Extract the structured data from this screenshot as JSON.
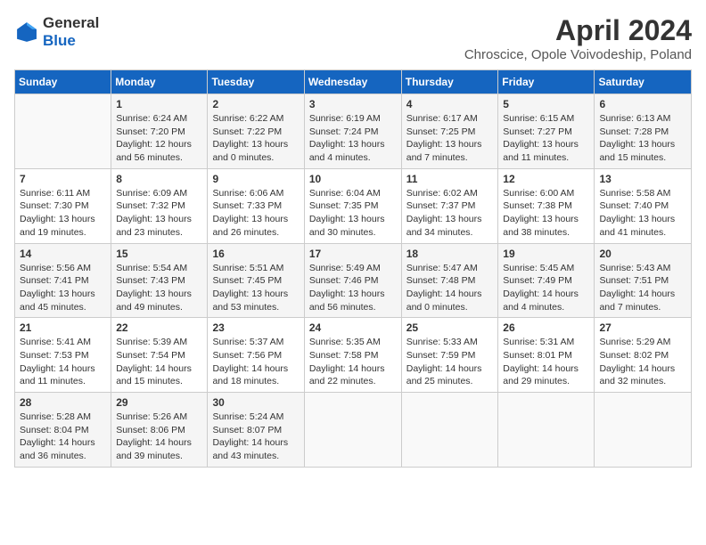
{
  "header": {
    "logo_line1": "General",
    "logo_line2": "Blue",
    "month_year": "April 2024",
    "location": "Chroscice, Opole Voivodeship, Poland"
  },
  "weekdays": [
    "Sunday",
    "Monday",
    "Tuesday",
    "Wednesday",
    "Thursday",
    "Friday",
    "Saturday"
  ],
  "weeks": [
    [
      {
        "day": "",
        "sunrise": "",
        "sunset": "",
        "daylight": ""
      },
      {
        "day": "1",
        "sunrise": "Sunrise: 6:24 AM",
        "sunset": "Sunset: 7:20 PM",
        "daylight": "Daylight: 12 hours and 56 minutes."
      },
      {
        "day": "2",
        "sunrise": "Sunrise: 6:22 AM",
        "sunset": "Sunset: 7:22 PM",
        "daylight": "Daylight: 13 hours and 0 minutes."
      },
      {
        "day": "3",
        "sunrise": "Sunrise: 6:19 AM",
        "sunset": "Sunset: 7:24 PM",
        "daylight": "Daylight: 13 hours and 4 minutes."
      },
      {
        "day": "4",
        "sunrise": "Sunrise: 6:17 AM",
        "sunset": "Sunset: 7:25 PM",
        "daylight": "Daylight: 13 hours and 7 minutes."
      },
      {
        "day": "5",
        "sunrise": "Sunrise: 6:15 AM",
        "sunset": "Sunset: 7:27 PM",
        "daylight": "Daylight: 13 hours and 11 minutes."
      },
      {
        "day": "6",
        "sunrise": "Sunrise: 6:13 AM",
        "sunset": "Sunset: 7:28 PM",
        "daylight": "Daylight: 13 hours and 15 minutes."
      }
    ],
    [
      {
        "day": "7",
        "sunrise": "Sunrise: 6:11 AM",
        "sunset": "Sunset: 7:30 PM",
        "daylight": "Daylight: 13 hours and 19 minutes."
      },
      {
        "day": "8",
        "sunrise": "Sunrise: 6:09 AM",
        "sunset": "Sunset: 7:32 PM",
        "daylight": "Daylight: 13 hours and 23 minutes."
      },
      {
        "day": "9",
        "sunrise": "Sunrise: 6:06 AM",
        "sunset": "Sunset: 7:33 PM",
        "daylight": "Daylight: 13 hours and 26 minutes."
      },
      {
        "day": "10",
        "sunrise": "Sunrise: 6:04 AM",
        "sunset": "Sunset: 7:35 PM",
        "daylight": "Daylight: 13 hours and 30 minutes."
      },
      {
        "day": "11",
        "sunrise": "Sunrise: 6:02 AM",
        "sunset": "Sunset: 7:37 PM",
        "daylight": "Daylight: 13 hours and 34 minutes."
      },
      {
        "day": "12",
        "sunrise": "Sunrise: 6:00 AM",
        "sunset": "Sunset: 7:38 PM",
        "daylight": "Daylight: 13 hours and 38 minutes."
      },
      {
        "day": "13",
        "sunrise": "Sunrise: 5:58 AM",
        "sunset": "Sunset: 7:40 PM",
        "daylight": "Daylight: 13 hours and 41 minutes."
      }
    ],
    [
      {
        "day": "14",
        "sunrise": "Sunrise: 5:56 AM",
        "sunset": "Sunset: 7:41 PM",
        "daylight": "Daylight: 13 hours and 45 minutes."
      },
      {
        "day": "15",
        "sunrise": "Sunrise: 5:54 AM",
        "sunset": "Sunset: 7:43 PM",
        "daylight": "Daylight: 13 hours and 49 minutes."
      },
      {
        "day": "16",
        "sunrise": "Sunrise: 5:51 AM",
        "sunset": "Sunset: 7:45 PM",
        "daylight": "Daylight: 13 hours and 53 minutes."
      },
      {
        "day": "17",
        "sunrise": "Sunrise: 5:49 AM",
        "sunset": "Sunset: 7:46 PM",
        "daylight": "Daylight: 13 hours and 56 minutes."
      },
      {
        "day": "18",
        "sunrise": "Sunrise: 5:47 AM",
        "sunset": "Sunset: 7:48 PM",
        "daylight": "Daylight: 14 hours and 0 minutes."
      },
      {
        "day": "19",
        "sunrise": "Sunrise: 5:45 AM",
        "sunset": "Sunset: 7:49 PM",
        "daylight": "Daylight: 14 hours and 4 minutes."
      },
      {
        "day": "20",
        "sunrise": "Sunrise: 5:43 AM",
        "sunset": "Sunset: 7:51 PM",
        "daylight": "Daylight: 14 hours and 7 minutes."
      }
    ],
    [
      {
        "day": "21",
        "sunrise": "Sunrise: 5:41 AM",
        "sunset": "Sunset: 7:53 PM",
        "daylight": "Daylight: 14 hours and 11 minutes."
      },
      {
        "day": "22",
        "sunrise": "Sunrise: 5:39 AM",
        "sunset": "Sunset: 7:54 PM",
        "daylight": "Daylight: 14 hours and 15 minutes."
      },
      {
        "day": "23",
        "sunrise": "Sunrise: 5:37 AM",
        "sunset": "Sunset: 7:56 PM",
        "daylight": "Daylight: 14 hours and 18 minutes."
      },
      {
        "day": "24",
        "sunrise": "Sunrise: 5:35 AM",
        "sunset": "Sunset: 7:58 PM",
        "daylight": "Daylight: 14 hours and 22 minutes."
      },
      {
        "day": "25",
        "sunrise": "Sunrise: 5:33 AM",
        "sunset": "Sunset: 7:59 PM",
        "daylight": "Daylight: 14 hours and 25 minutes."
      },
      {
        "day": "26",
        "sunrise": "Sunrise: 5:31 AM",
        "sunset": "Sunset: 8:01 PM",
        "daylight": "Daylight: 14 hours and 29 minutes."
      },
      {
        "day": "27",
        "sunrise": "Sunrise: 5:29 AM",
        "sunset": "Sunset: 8:02 PM",
        "daylight": "Daylight: 14 hours and 32 minutes."
      }
    ],
    [
      {
        "day": "28",
        "sunrise": "Sunrise: 5:28 AM",
        "sunset": "Sunset: 8:04 PM",
        "daylight": "Daylight: 14 hours and 36 minutes."
      },
      {
        "day": "29",
        "sunrise": "Sunrise: 5:26 AM",
        "sunset": "Sunset: 8:06 PM",
        "daylight": "Daylight: 14 hours and 39 minutes."
      },
      {
        "day": "30",
        "sunrise": "Sunrise: 5:24 AM",
        "sunset": "Sunset: 8:07 PM",
        "daylight": "Daylight: 14 hours and 43 minutes."
      },
      {
        "day": "",
        "sunrise": "",
        "sunset": "",
        "daylight": ""
      },
      {
        "day": "",
        "sunrise": "",
        "sunset": "",
        "daylight": ""
      },
      {
        "day": "",
        "sunrise": "",
        "sunset": "",
        "daylight": ""
      },
      {
        "day": "",
        "sunrise": "",
        "sunset": "",
        "daylight": ""
      }
    ]
  ]
}
